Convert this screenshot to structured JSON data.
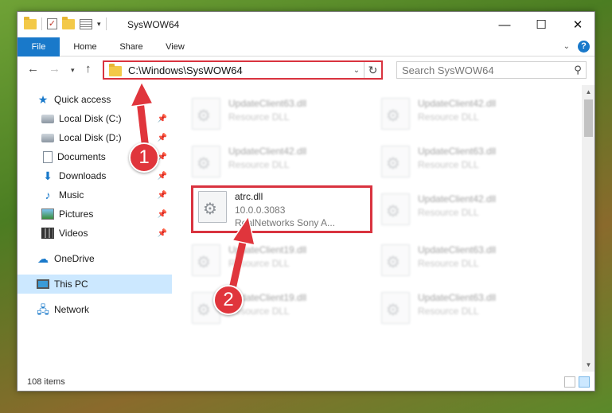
{
  "window": {
    "title": "SysWOW64"
  },
  "ribbon": {
    "tabs": [
      "File",
      "Home",
      "Share",
      "View"
    ]
  },
  "nav": {
    "address": "C:\\Windows\\SysWOW64",
    "search_placeholder": "Search SysWOW64"
  },
  "sidebar": {
    "items": [
      {
        "label": "Quick access",
        "icon": "star-icon",
        "pinned": false
      },
      {
        "label": "Local Disk (C:)",
        "icon": "drive-icon",
        "pinned": true
      },
      {
        "label": "Local Disk (D:)",
        "icon": "drive-icon",
        "pinned": true
      },
      {
        "label": "Documents",
        "icon": "documents-icon",
        "pinned": true
      },
      {
        "label": "Downloads",
        "icon": "download-icon",
        "pinned": true
      },
      {
        "label": "Music",
        "icon": "music-icon",
        "pinned": true
      },
      {
        "label": "Pictures",
        "icon": "pictures-icon",
        "pinned": true
      },
      {
        "label": "Videos",
        "icon": "videos-icon",
        "pinned": true
      },
      {
        "label": "OneDrive",
        "icon": "cloud-icon",
        "pinned": false
      },
      {
        "label": "This PC",
        "icon": "computer-icon",
        "pinned": false,
        "selected": true
      },
      {
        "label": "Network",
        "icon": "network-icon",
        "pinned": false
      }
    ]
  },
  "files": {
    "left": [
      {
        "name": "UpdateClient63.dll",
        "line1": "Resource DLL"
      },
      {
        "name": "UpdateClient42.dll",
        "line1": "Resource DLL"
      },
      {
        "name": "atrc.dll",
        "line1": "10.0.0.3083",
        "line2": "RealNetworks Sony A...",
        "highlight": true
      },
      {
        "name": "UpdateClient19.dll",
        "line1": "Resource DLL"
      },
      {
        "name": "UpdateClient19.dll",
        "line1": "Resource DLL"
      }
    ],
    "right": [
      {
        "name": "UpdateClient42.dll",
        "line1": "Resource DLL"
      },
      {
        "name": "UpdateClient63.dll",
        "line1": "Resource DLL"
      },
      {
        "name": "UpdateClient42.dll",
        "line1": "Resource DLL"
      },
      {
        "name": "UpdateClient63.dll",
        "line1": "Resource DLL"
      },
      {
        "name": "UpdateClient63.dll",
        "line1": "Resource DLL"
      }
    ]
  },
  "status": {
    "count": "108 items"
  },
  "annotations": {
    "badge1": "1",
    "badge2": "2"
  },
  "colors": {
    "accent": "#1979ca",
    "highlight": "#d9333f",
    "selection": "#cce8ff"
  }
}
